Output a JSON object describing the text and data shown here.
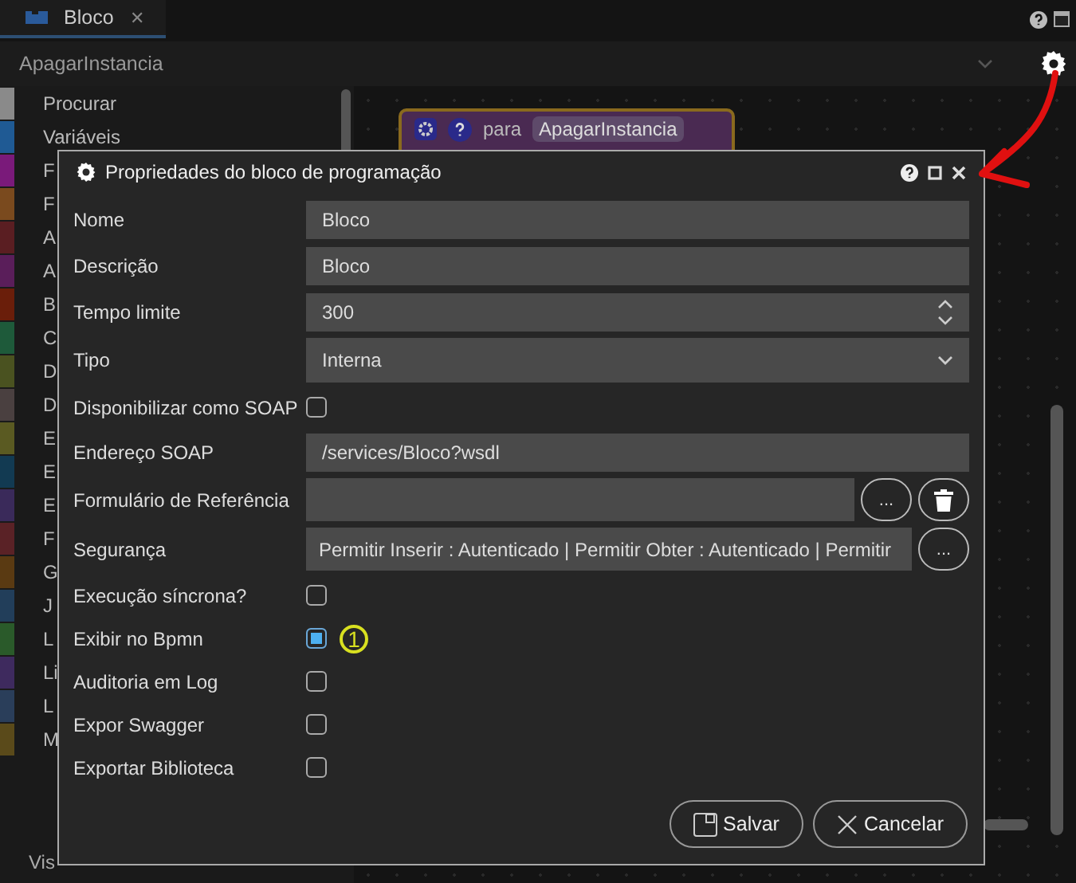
{
  "tab": {
    "label": "Bloco",
    "close": "✕"
  },
  "instance_bar": {
    "value": "ApagarInstancia"
  },
  "palette": [
    {
      "label": "Procurar",
      "color": "#8a8a8a"
    },
    {
      "label": "Variáveis",
      "color": "#1f5a94"
    },
    {
      "label": "F",
      "color": "#7a1a7a"
    },
    {
      "label": "F",
      "color": "#7a4a1e"
    },
    {
      "label": "A",
      "color": "#5a1e22"
    },
    {
      "label": "A",
      "color": "#5a1e5a"
    },
    {
      "label": "B",
      "color": "#6a1e0a"
    },
    {
      "label": "C",
      "color": "#1e5a3a"
    },
    {
      "label": "D",
      "color": "#4a5220"
    },
    {
      "label": "D",
      "color": "#4a4040"
    },
    {
      "label": "E",
      "color": "#5a5a22"
    },
    {
      "label": "E",
      "color": "#123a52"
    },
    {
      "label": "E",
      "color": "#3a2a5a"
    },
    {
      "label": "F",
      "color": "#5a2226"
    },
    {
      "label": "G",
      "color": "#5a3a12"
    },
    {
      "label": "J",
      "color": "#223e5a"
    },
    {
      "label": "L",
      "color": "#2a5a2a"
    },
    {
      "label": "Li",
      "color": "#3e2a5e"
    },
    {
      "label": "L",
      "color": "#2a3e5a"
    },
    {
      "label": "M",
      "color": "#5a4a1a"
    }
  ],
  "palette_footer": "Vis",
  "block": {
    "keyword": "para",
    "name": "ApagarInstancia"
  },
  "dialog": {
    "title": "Propriedades do bloco de programação",
    "fields": [
      {
        "kind": "text",
        "label": "Nome",
        "value": "Bloco"
      },
      {
        "kind": "text",
        "label": "Descrição",
        "value": "Bloco"
      },
      {
        "kind": "number",
        "label": "Tempo limite",
        "value": "300"
      },
      {
        "kind": "select",
        "label": "Tipo",
        "value": "Interna"
      },
      {
        "kind": "checkbox",
        "label": "Disponibilizar como SOAP",
        "checked": false
      },
      {
        "kind": "text",
        "label": "Endereço SOAP",
        "value": "/services/Bloco?wsdl"
      },
      {
        "kind": "picker",
        "label": "Formulário de Referência",
        "button": "...",
        "delete": true
      },
      {
        "kind": "picker",
        "label": "Segurança",
        "value": "Permitir Inserir : Autenticado | Permitir Obter : Autenticado | Permitir",
        "button": "...",
        "delete": false
      },
      {
        "kind": "checkbox",
        "label": "Execução síncrona?",
        "checked": false
      },
      {
        "kind": "checkbox",
        "label": "Exibir no Bpmn",
        "checked": true,
        "marker": "1"
      },
      {
        "kind": "checkbox",
        "label": "Auditoria em Log",
        "checked": false
      },
      {
        "kind": "checkbox",
        "label": "Expor Swagger",
        "checked": false
      },
      {
        "kind": "checkbox",
        "label": "Exportar Biblioteca",
        "checked": false
      }
    ],
    "buttons": [
      {
        "kind": "save",
        "label": "Salvar"
      },
      {
        "kind": "cancel",
        "label": "Cancelar"
      }
    ]
  }
}
